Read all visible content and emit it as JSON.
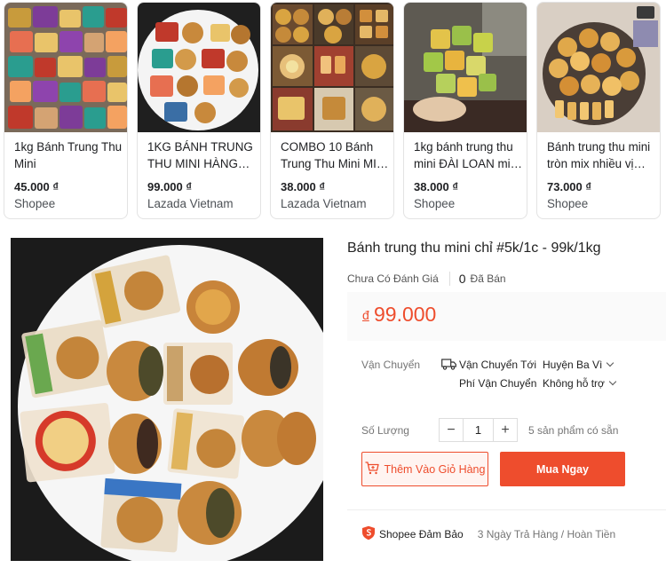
{
  "cards": [
    {
      "title": "1kg Bánh Trung Thu Mini",
      "price": "45.000 ₫",
      "store": "Shopee"
    },
    {
      "title": "1KG BÁNH TRUNG THU MINI HÀNG…",
      "price": "99.000 ₫",
      "store": "Lazada Vietnam"
    },
    {
      "title": "COMBO 10 Bánh Trung Thu Mini MI…",
      "price": "38.000 ₫",
      "store": "Lazada Vietnam"
    },
    {
      "title": "1kg bánh trung thu mini ĐÀI LOAN mi…",
      "price": "38.000 ₫",
      "store": "Shopee"
    },
    {
      "title": "Bánh trung thu mini tròn mix nhiều vị…",
      "price": "73.000 ₫",
      "store": "Shopee"
    }
  ],
  "product": {
    "title": "Bánh trung thu mini chỉ #5k/1c - 99k/1kg",
    "rating_text": "Chưa Có Đánh Giá",
    "sold_count": "0",
    "sold_label": "Đã Bán",
    "currency": "đ",
    "price": "99.000"
  },
  "shipping": {
    "label": "Vận Chuyển",
    "to_label": "Vận Chuyển Tới",
    "to_value": "Huyện Ba Vì",
    "fee_label": "Phí Vận Chuyển",
    "fee_value": "Không hỗ trợ"
  },
  "quantity": {
    "label": "Số Lượng",
    "minus": "−",
    "value": "1",
    "plus": "+",
    "stock": "5 sản phẩm có sẵn"
  },
  "actions": {
    "add_to_cart": "Thêm Vào Giỏ Hàng",
    "buy_now": "Mua Ngay"
  },
  "guarantee": {
    "name": "Shopee Đảm Bảo",
    "desc": "3 Ngày Trả Hàng / Hoàn Tiền"
  },
  "colors": {
    "accent": "#ee4d2d",
    "price_box_bg": "#fafafa"
  },
  "icons": [
    "truck-icon",
    "cart-icon",
    "shield-icon",
    "chevron-down-icon"
  ]
}
